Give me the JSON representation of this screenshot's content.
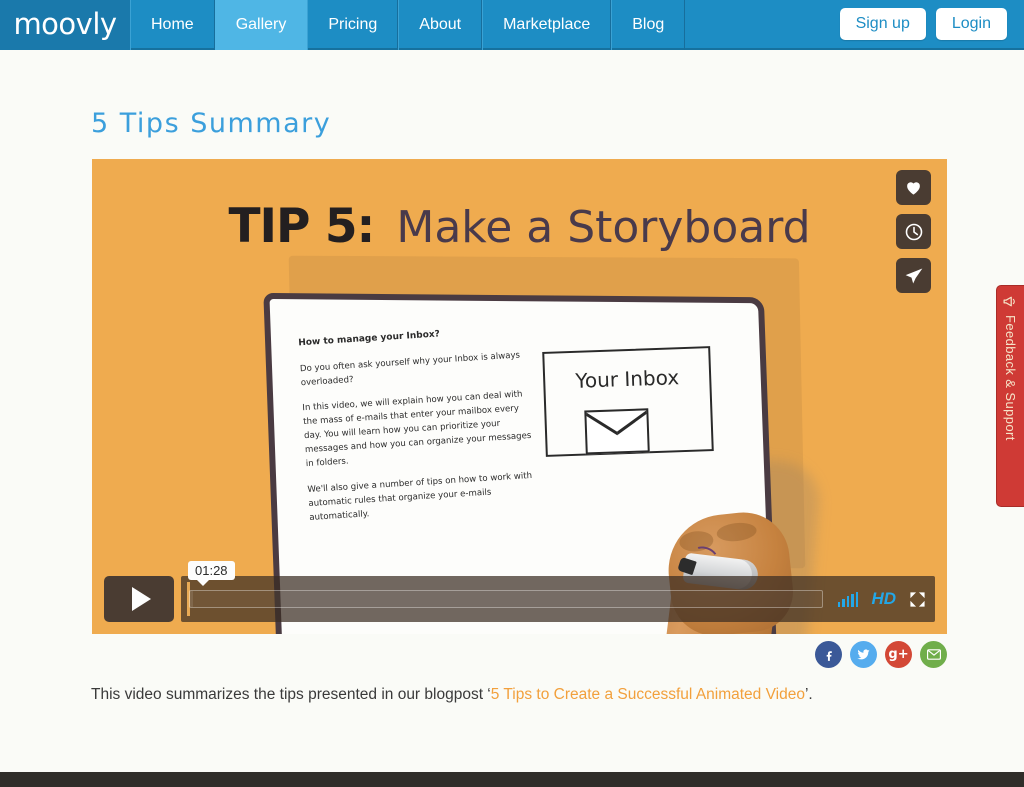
{
  "nav": {
    "logo": "moovly",
    "links": [
      {
        "label": "Home",
        "active": false
      },
      {
        "label": "Gallery",
        "active": true
      },
      {
        "label": "Pricing",
        "active": false
      },
      {
        "label": "About",
        "active": false
      },
      {
        "label": "Marketplace",
        "active": false
      },
      {
        "label": "Blog",
        "active": false
      }
    ],
    "signup_label": "Sign up",
    "login_label": "Login",
    "bg_color": "#1d8dc4",
    "active_color": "#4fb6e5"
  },
  "page": {
    "title": "5 Tips Summary",
    "title_color": "#3b9fdc"
  },
  "video": {
    "bg_color": "#efab4f",
    "title_prefix": "TIP 5:",
    "title_main": "Make a Storyboard",
    "board": {
      "heading": "How to manage your Inbox?",
      "paragraphs": [
        "Do you often ask yourself why your Inbox is always overloaded?",
        "In this video, we will explain how you can deal with the mass of e-mails that enter your mailbox every day. You will learn how you can prioritize your messages and how you can organize your messages in folders.",
        "We'll also give a number of tips on how to work with automatic rules that organize your e-mails automatically."
      ],
      "inbox_label": "Your Inbox"
    },
    "actions": [
      {
        "name": "favorite",
        "icon": "heart-icon"
      },
      {
        "name": "watch-later",
        "icon": "clock-icon"
      },
      {
        "name": "share",
        "icon": "paper-plane-icon"
      }
    ],
    "controls": {
      "play_label": "Play",
      "current_time": "01:28",
      "hd_label": "HD",
      "volume_label": "Volume",
      "fullscreen_label": "Fullscreen",
      "progress_percent": 0.4
    }
  },
  "social": [
    {
      "label": "f",
      "name": "facebook",
      "color": "#3b5998"
    },
    {
      "label": "❤",
      "name": "twitter",
      "color": "#55acee"
    },
    {
      "label": "g+",
      "name": "google-plus",
      "color": "#d34836"
    },
    {
      "label": "✉",
      "name": "email",
      "color": "#70ae4b"
    }
  ],
  "description": {
    "before": "This video summarizes the tips presented in our blogpost ‘",
    "link": "5 Tips to Create a Successful Animated Video",
    "after": "’.",
    "link_color": "#f2a03c"
  },
  "feedback": {
    "label": "Feedback & Support",
    "color": "#cf3a35"
  }
}
